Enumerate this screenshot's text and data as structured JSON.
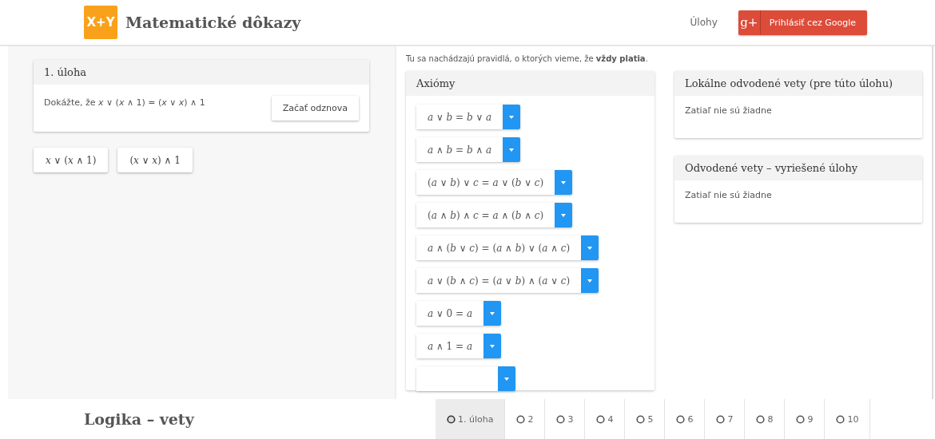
{
  "header": {
    "logo": "X+Y",
    "title": "Matematické dôkazy",
    "nav_link": "Úlohy",
    "login_button": "Prihlásiť cez Google",
    "login_icon": "g+"
  },
  "task": {
    "title": "1. úloha",
    "statement": "Dokážte, že *x* ∨ (*x* ∧ 1) = (*x* ∨ *x*) ∧ 1",
    "restart_button": "Začať odznova"
  },
  "expressions": [
    "*x* ∨ (*x* ∧ 1)",
    "(*x* ∨ *x*) ∧ 1"
  ],
  "intro": "Tu sa nachádzajú pravidlá, o ktorých vieme, že **vždy platia**.",
  "axioms": {
    "title": "Axiómy",
    "items": [
      {
        "kind": "full",
        "formula": "*a* ∨ *b* = *b* ∨ *a*"
      },
      {
        "kind": "full",
        "formula": "*a* ∧ *b* = *b* ∧ *a*"
      },
      {
        "kind": "full",
        "formula": "(*a* ∨ *b*) ∨ *c* = *a* ∨ (*b* ∨ *c*)"
      },
      {
        "kind": "full",
        "formula": "(*a* ∧ *b*) ∧ *c* = *a* ∧ (*b* ∧ *c*)"
      },
      {
        "kind": "full",
        "formula": "*a* ∧ (*b* ∨ *c*) = (*a* ∧ *b*) ∨ (*a* ∧ *c*)"
      },
      {
        "kind": "full",
        "formula": "*a* ∨ (*b* ∧ *c*) = (*a* ∨ *b*) ∧ (*a* ∨ *c*)"
      },
      {
        "kind": "full",
        "formula": "*a* ∨ 0 = *a*"
      },
      {
        "kind": "full",
        "formula": "*a* ∧ 1 = *a*"
      },
      {
        "kind": "partial"
      }
    ]
  },
  "local_theorems": {
    "title": "Lokálne odvodené vety (pre túto úlohu)",
    "empty_text": "Zatiaľ nie sú žiadne"
  },
  "solved_theorems": {
    "title": "Odvodené vety – vyriešené úlohy",
    "empty_text": "Zatiaľ nie sú žiadne"
  },
  "footer": {
    "title": "Logika – vety",
    "tabs": [
      {
        "label": "1. úloha",
        "selected": true
      },
      {
        "label": "2",
        "selected": false
      },
      {
        "label": "3",
        "selected": false
      },
      {
        "label": "4",
        "selected": false
      },
      {
        "label": "5",
        "selected": false
      },
      {
        "label": "6",
        "selected": false
      },
      {
        "label": "7",
        "selected": false
      },
      {
        "label": "8",
        "selected": false
      },
      {
        "label": "9",
        "selected": false
      },
      {
        "label": "10",
        "selected": false
      }
    ]
  }
}
